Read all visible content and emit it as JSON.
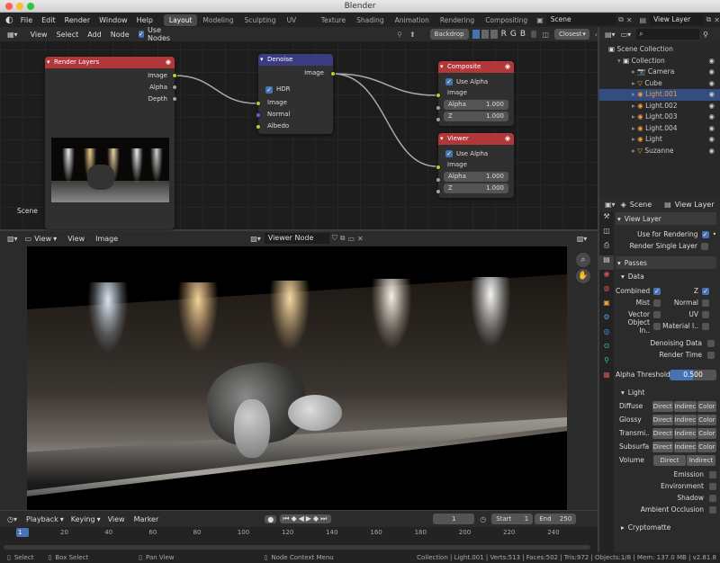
{
  "window": {
    "title": "Blender"
  },
  "topbar": {
    "menus": [
      "File",
      "Edit",
      "Render",
      "Window",
      "Help"
    ],
    "workspaces": [
      "Layout",
      "Modeling",
      "Sculpting",
      "UV Editing",
      "Texture Paint",
      "Shading",
      "Animation",
      "Rendering",
      "Compositing"
    ],
    "active_workspace": "Layout",
    "scene": "Scene",
    "view_layer": "View Layer"
  },
  "node_editor": {
    "menus": [
      "View",
      "Select",
      "Add",
      "Node"
    ],
    "use_nodes": "Use Nodes",
    "backdrop": "Backdrop",
    "channels": [
      "R",
      "G",
      "B"
    ],
    "filter": "Closest",
    "frame_label": "Scene",
    "render_layers": {
      "title": "Render Layers",
      "outputs": [
        "Image",
        "Alpha",
        "Depth"
      ]
    },
    "denoise": {
      "title": "Denoise",
      "output": "Image",
      "hdr": "HDR",
      "inputs": [
        "Image",
        "Normal",
        "Albedo"
      ]
    },
    "composite": {
      "title": "Composite",
      "use_alpha": "Use Alpha",
      "image": "Image",
      "alpha_label": "Alpha",
      "alpha_value": "1.000",
      "z_label": "Z",
      "z_value": "1.000"
    },
    "viewer": {
      "title": "Viewer",
      "use_alpha": "Use Alpha",
      "image": "Image",
      "alpha_label": "Alpha",
      "alpha_value": "1.000",
      "z_label": "Z",
      "z_value": "1.000"
    }
  },
  "image_editor": {
    "menus": [
      "View",
      "View",
      "Image"
    ],
    "image_name": "Viewer Node"
  },
  "outliner": {
    "title": "Scene Collection",
    "items": [
      {
        "label": "Collection",
        "color": "#ccc"
      },
      {
        "label": "Camera",
        "color": "#ccc"
      },
      {
        "label": "Cube",
        "color": "#ccc"
      },
      {
        "label": "Light.001",
        "color": "#f0a040"
      },
      {
        "label": "Light.002",
        "color": "#ccc"
      },
      {
        "label": "Light.003",
        "color": "#ccc"
      },
      {
        "label": "Light.004",
        "color": "#ccc"
      },
      {
        "label": "Light",
        "color": "#ccc"
      },
      {
        "label": "Suzanne",
        "color": "#ccc"
      }
    ]
  },
  "properties": {
    "scene": "Scene",
    "view_layer": "View Layer",
    "view_layer_panel": "View Layer",
    "use_for_rendering": "Use for Rendering",
    "render_single_layer": "Render Single Layer",
    "passes": "Passes",
    "data": "Data",
    "combined": "Combined",
    "z": "Z",
    "mist": "Mist",
    "normal": "Normal",
    "vector": "Vector",
    "uv": "UV",
    "object_index": "Object In..",
    "material_index": "Material I..",
    "denoising_data": "Denoising Data",
    "render_time": "Render Time",
    "alpha_threshold": "Alpha Threshold",
    "alpha_threshold_value": "0.500",
    "light": "Light",
    "light_rows": [
      {
        "label": "Diffuse",
        "a": "Direct",
        "b": "Indirec",
        "c": "Color"
      },
      {
        "label": "Glossy",
        "a": "Direct",
        "b": "Indirec",
        "c": "Color"
      },
      {
        "label": "Transmi...",
        "a": "Direct",
        "b": "Indirec",
        "c": "Color"
      },
      {
        "label": "Subsurfa...",
        "a": "Direct",
        "b": "Indirec",
        "c": "Color"
      }
    ],
    "volume": "Volume",
    "volume_a": "Direct",
    "volume_b": "Indirect",
    "emission": "Emission",
    "environment": "Environment",
    "shadow": "Shadow",
    "ambient_occlusion": "Ambient Occlusion",
    "cryptomatte": "Cryptomatte"
  },
  "timeline": {
    "menus": [
      "Playback",
      "Keying",
      "View",
      "Marker"
    ],
    "current_frame": "1",
    "start_label": "Start",
    "start": "1",
    "end_label": "End",
    "end": "250",
    "ticks": [
      "1",
      "20",
      "40",
      "60",
      "80",
      "100",
      "120",
      "140",
      "160",
      "180",
      "200",
      "220",
      "240"
    ]
  },
  "statusbar": {
    "select": "Select",
    "box_select": "Box Select",
    "pan_view": "Pan View",
    "context_menu": "Node Context Menu",
    "stats": "Collection | Light.001 | Verts:513 | Faces:502 | Tris:972 | Objects:1/8 | Mem: 137.0 MB | v2.81.8"
  }
}
